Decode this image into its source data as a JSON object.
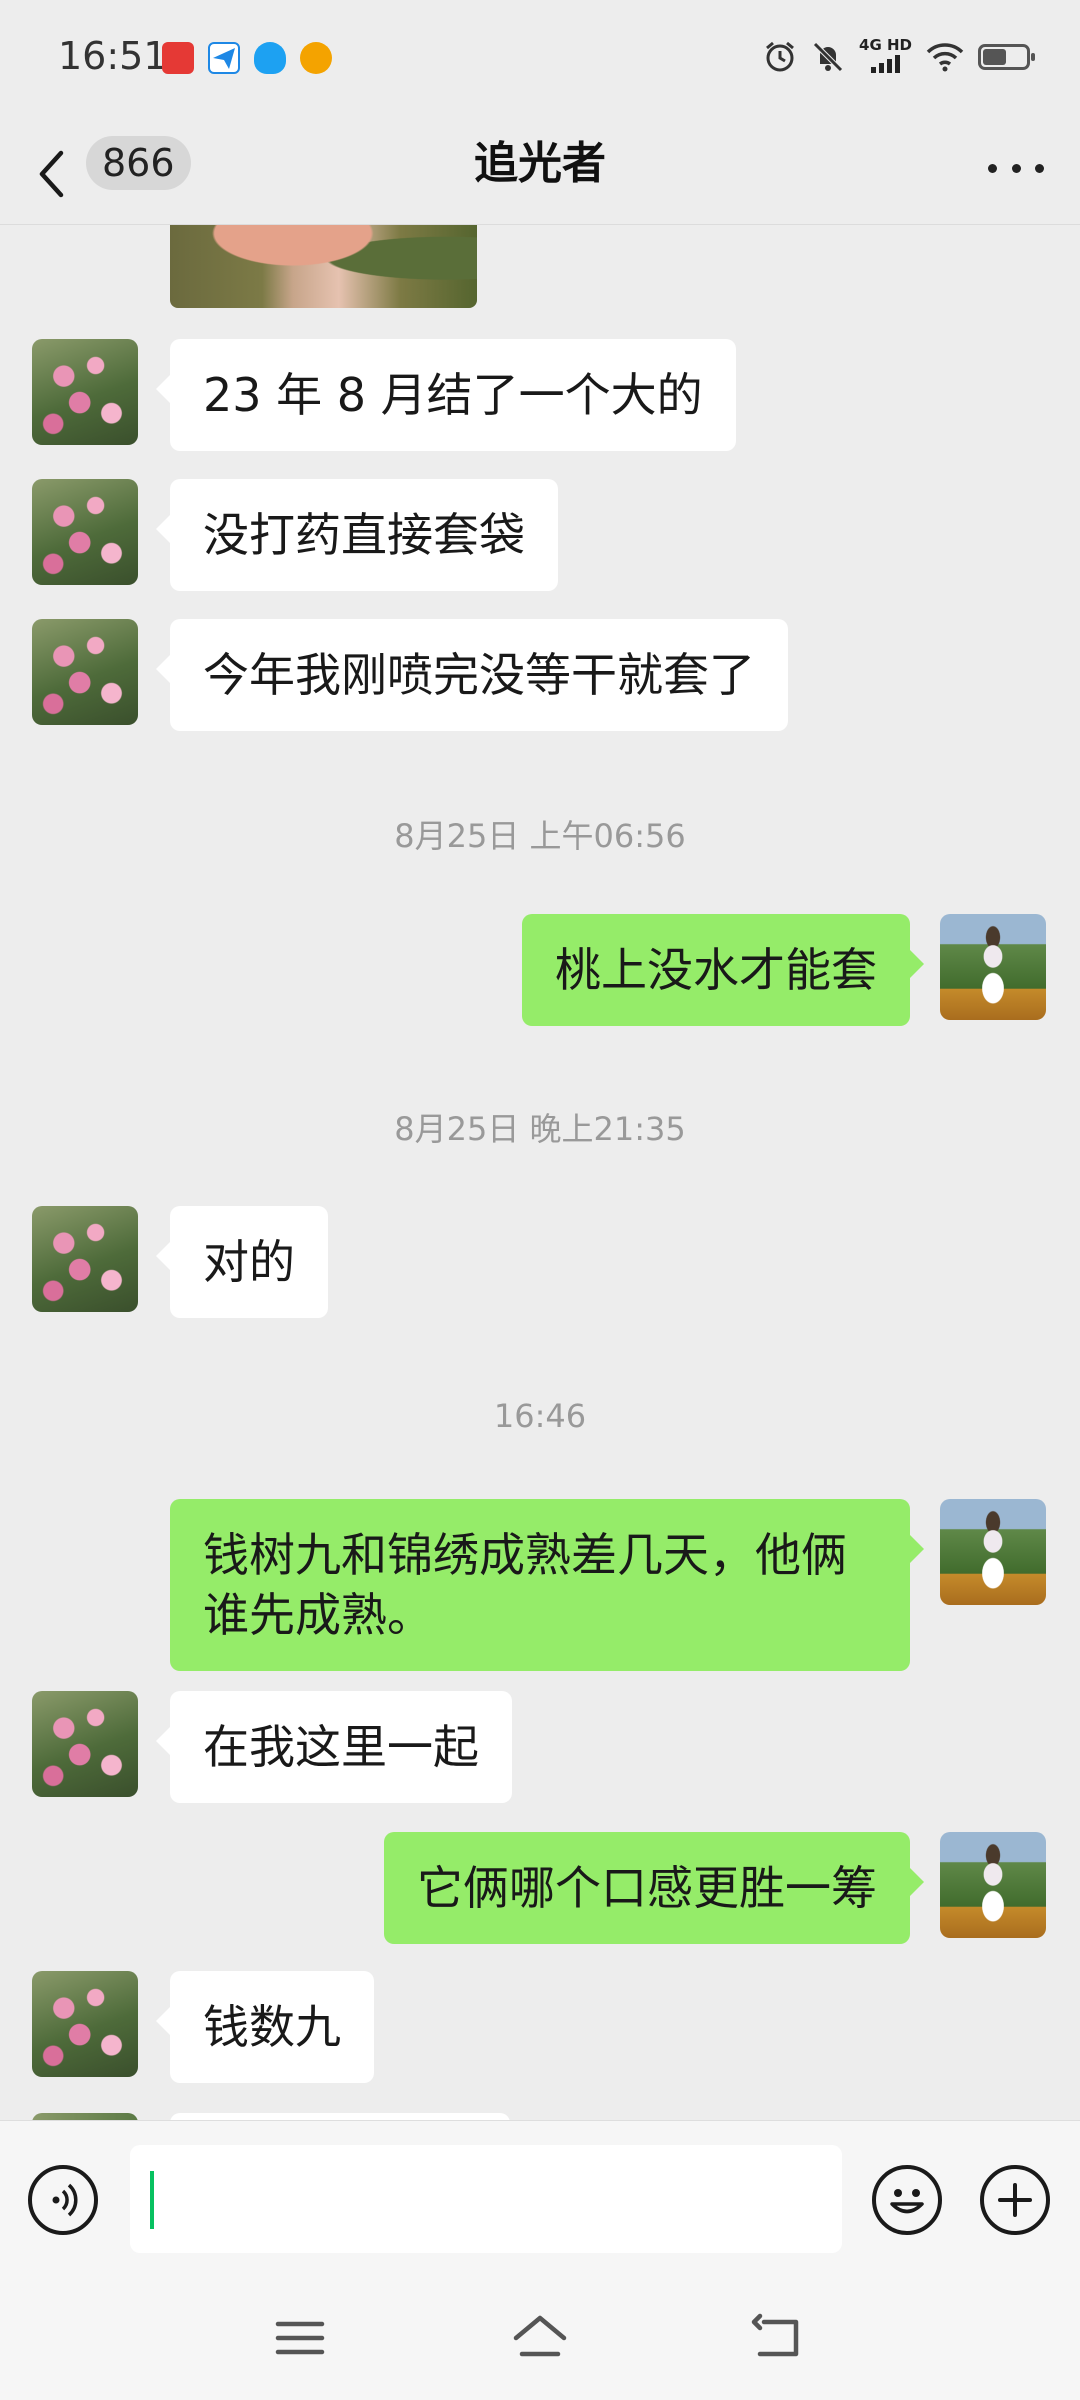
{
  "status_bar": {
    "time": "16:51",
    "apps": [
      {
        "icon": "red-app-icon",
        "color": "#e53935"
      },
      {
        "icon": "paper-plane-icon",
        "color": "#1e88e5"
      },
      {
        "icon": "qq-penguin-icon",
        "color": "#1da1f2"
      },
      {
        "icon": "weibo-icon",
        "color": "#f4a300"
      }
    ],
    "network_top": "4G HD",
    "network_bottom": "",
    "battery_level": 0.55
  },
  "header": {
    "unread_count": "866",
    "title": "追光者"
  },
  "messages": [
    {
      "side": "left",
      "text": "23 年 8 月结了一个大的"
    },
    {
      "side": "left",
      "text": "没打药直接套袋"
    },
    {
      "side": "left",
      "text": "今年我刚喷完没等干就套了"
    },
    {
      "timestamp": "8月25日 上午06:56"
    },
    {
      "side": "right",
      "text": "桃上没水才能套"
    },
    {
      "timestamp": "8月25日 晚上21:35"
    },
    {
      "side": "left",
      "text": "对的"
    },
    {
      "timestamp": "16:46"
    },
    {
      "side": "right",
      "text": "钱树九和锦绣成熟差几天，他俩谁先成熟。"
    },
    {
      "side": "left",
      "text": "在我这里一起"
    },
    {
      "side": "right",
      "text": "它俩哪个口感更胜一筹"
    },
    {
      "side": "left",
      "text": "钱数九"
    }
  ],
  "colors": {
    "background": "#ededed",
    "bubble_self": "#95ec69",
    "bubble_other": "#ffffff",
    "caret": "#07c160"
  }
}
